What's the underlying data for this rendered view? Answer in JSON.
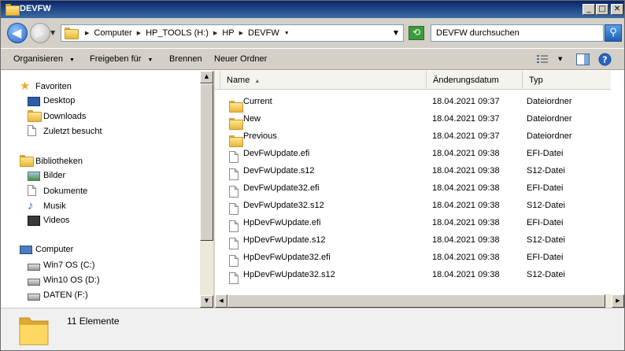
{
  "window": {
    "title": "DEVFW"
  },
  "titlebar_buttons": {
    "minimize": "_",
    "maximize": "□",
    "close": "✕"
  },
  "address": {
    "crumbs": [
      "Computer",
      "HP_TOOLS (H:)",
      "HP",
      "DEVFW"
    ]
  },
  "search": {
    "placeholder": "DEVFW durchsuchen"
  },
  "toolbar": {
    "organize": "Organisieren",
    "share": "Freigeben für",
    "burn": "Brennen",
    "new_folder": "Neuer Ordner"
  },
  "nav": {
    "favorites": {
      "label": "Favoriten",
      "items": [
        "Desktop",
        "Downloads",
        "Zuletzt besucht"
      ]
    },
    "libraries": {
      "label": "Bibliotheken",
      "items": [
        "Bilder",
        "Dokumente",
        "Musik",
        "Videos"
      ]
    },
    "computer": {
      "label": "Computer",
      "items": [
        "Win7 OS (C:)",
        "Win10 OS (D:)",
        "DATEN (F:)"
      ]
    }
  },
  "columns": {
    "name": "Name",
    "date": "Änderungsdatum",
    "type": "Typ"
  },
  "files": [
    {
      "name": "Current",
      "date": "18.04.2021 09:37",
      "type": "Dateiordner",
      "icon": "folder-icon"
    },
    {
      "name": "New",
      "date": "18.04.2021 09:37",
      "type": "Dateiordner",
      "icon": "folder-icon"
    },
    {
      "name": "Previous",
      "date": "18.04.2021 09:37",
      "type": "Dateiordner",
      "icon": "folder-icon"
    },
    {
      "name": "DevFwUpdate.efi",
      "date": "18.04.2021 09:38",
      "type": "EFI-Datei",
      "icon": "file-icon"
    },
    {
      "name": "DevFwUpdate.s12",
      "date": "18.04.2021 09:38",
      "type": "S12-Datei",
      "icon": "file-icon"
    },
    {
      "name": "DevFwUpdate32.efi",
      "date": "18.04.2021 09:38",
      "type": "EFI-Datei",
      "icon": "file-icon"
    },
    {
      "name": "DevFwUpdate32.s12",
      "date": "18.04.2021 09:38",
      "type": "S12-Datei",
      "icon": "file-icon"
    },
    {
      "name": "HpDevFwUpdate.efi",
      "date": "18.04.2021 09:38",
      "type": "EFI-Datei",
      "icon": "file-icon"
    },
    {
      "name": "HpDevFwUpdate.s12",
      "date": "18.04.2021 09:38",
      "type": "S12-Datei",
      "icon": "file-icon"
    },
    {
      "name": "HpDevFwUpdate32.efi",
      "date": "18.04.2021 09:38",
      "type": "EFI-Datei",
      "icon": "file-icon"
    },
    {
      "name": "HpDevFwUpdate32.s12",
      "date": "18.04.2021 09:38",
      "type": "S12-Datei",
      "icon": "file-icon"
    }
  ],
  "details": {
    "count": "11 Elemente"
  }
}
